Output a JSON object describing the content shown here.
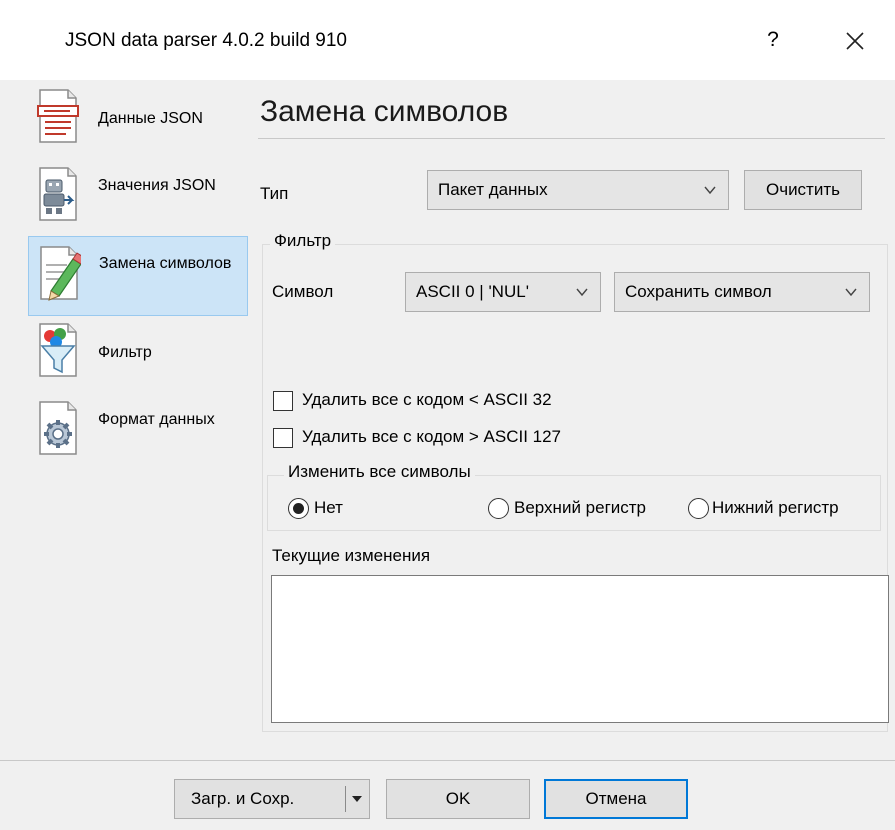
{
  "window": {
    "title": "JSON data parser 4.0.2 build 910",
    "help_symbol": "?"
  },
  "sidebar": {
    "items": [
      {
        "label": "Данные JSON",
        "icon": "document-icon"
      },
      {
        "label": "Значения JSON",
        "icon": "robot-document-icon"
      },
      {
        "label": "Замена символов",
        "icon": "pencil-icon",
        "selected": true
      },
      {
        "label": "Фильтр",
        "icon": "funnel-icon"
      },
      {
        "label": "Формат данных",
        "icon": "gear-document-icon"
      }
    ]
  },
  "page": {
    "title": "Замена символов",
    "type_label": "Тип",
    "type_value": "Пакет данных",
    "clear_button": "Очистить",
    "filter_group": "Фильтр",
    "symbol_label": "Символ",
    "symbol_value": "ASCII 0 | 'NUL'",
    "action_value": "Сохранить символ",
    "check_delete_lt": {
      "label": "Удалить все с кодом < ASCII 32",
      "checked": false
    },
    "check_delete_gt": {
      "label": "Удалить все с кодом > ASCII 127",
      "checked": false
    },
    "case_group": "Изменить все символы",
    "case_options": [
      {
        "label": "Нет",
        "checked": true
      },
      {
        "label": "Верхний регистр",
        "checked": false
      },
      {
        "label": "Нижний регистр",
        "checked": false
      }
    ],
    "current_changes_label": "Текущие изменения",
    "current_changes_value": ""
  },
  "footer": {
    "load_save_button": "Загр. и Сохр.",
    "ok_button": "OK",
    "cancel_button": "Отмена"
  },
  "colors": {
    "selected_bg": "#cce4f7",
    "default_button_border": "#0078d7"
  }
}
